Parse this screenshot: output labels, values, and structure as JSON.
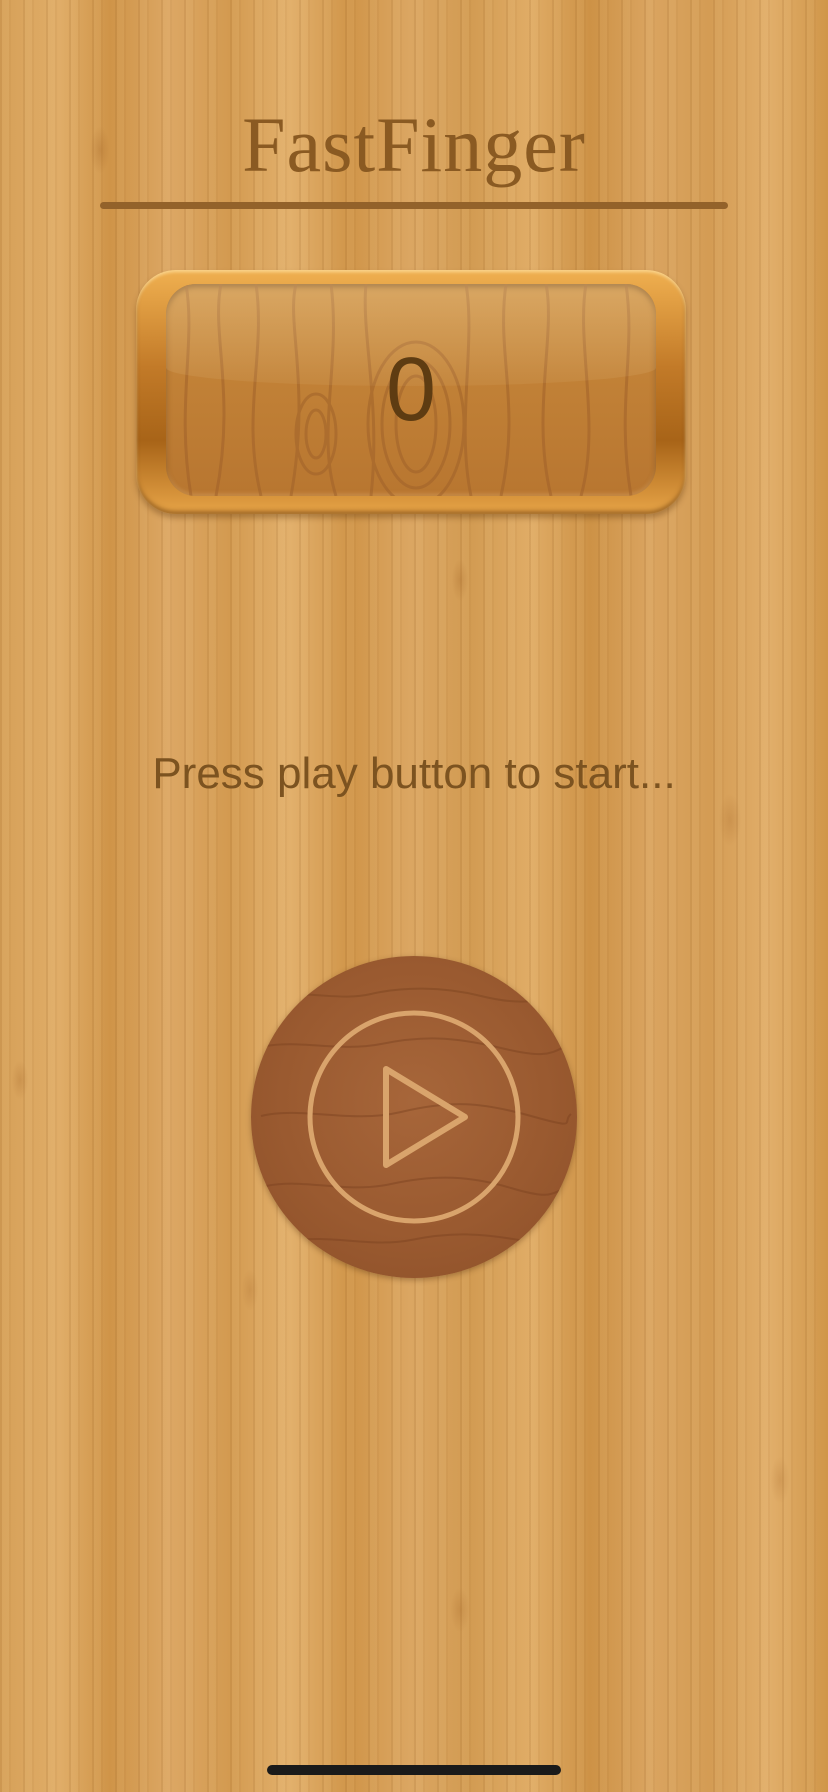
{
  "app": {
    "title": "FastFinger"
  },
  "score": {
    "value": "0"
  },
  "instruction": {
    "text": "Press play button to start..."
  },
  "play_button": {
    "icon": "play-icon"
  },
  "colors": {
    "title": "#8a5a22",
    "score_text": "#5e3c12",
    "instruction_text": "#7c5320",
    "play_button": "#9a5a30",
    "wood_background": "#d9a256"
  }
}
